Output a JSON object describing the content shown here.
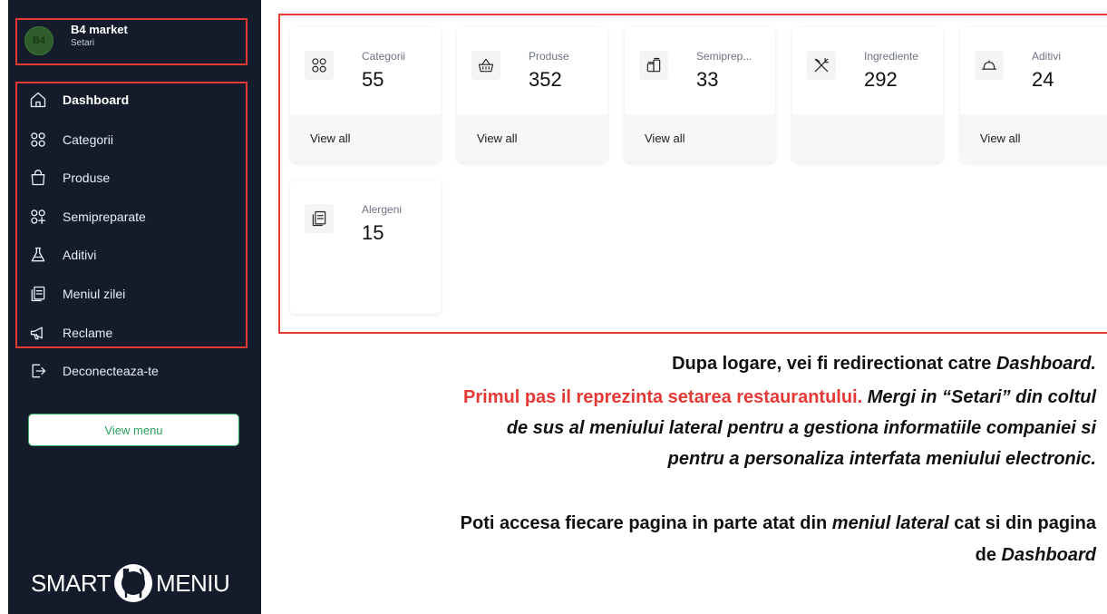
{
  "brand": {
    "avatar_text": "B4",
    "name": "B4 market",
    "subtitle": "Setari"
  },
  "nav": [
    {
      "label": "Dashboard",
      "icon": "home-icon",
      "active": true
    },
    {
      "label": "Categorii",
      "icon": "grid-icon",
      "active": false
    },
    {
      "label": "Produse",
      "icon": "bag-icon",
      "active": false
    },
    {
      "label": "Semipreparate",
      "icon": "grid-plus-icon",
      "active": false
    },
    {
      "label": "Aditivi",
      "icon": "flask-icon",
      "active": false
    },
    {
      "label": "Meniul zilei",
      "icon": "clipboard-icon",
      "active": false
    },
    {
      "label": "Reclame",
      "icon": "megaphone-icon",
      "active": false
    }
  ],
  "logout": {
    "label": "Deconecteaza-te",
    "icon": "logout-icon"
  },
  "view_menu": "View menu",
  "logo": {
    "left": "SMART",
    "right": "MENIU"
  },
  "cards": [
    {
      "label": "Categorii",
      "value": "55",
      "icon": "grid-icon",
      "link": "View all"
    },
    {
      "label": "Produse",
      "value": "352",
      "icon": "basket-icon",
      "link": "View all"
    },
    {
      "label": "Semiprep...",
      "value": "33",
      "icon": "jars-icon",
      "link": "View all"
    },
    {
      "label": "Ingrediente",
      "value": "292",
      "icon": "utensils-icon",
      "link": ""
    },
    {
      "label": "Aditivi",
      "value": "24",
      "icon": "cloche-icon",
      "link": "View all"
    },
    {
      "label": "Alergeni",
      "value": "15",
      "icon": "clipboard-icon",
      "link": ""
    }
  ],
  "text": {
    "line1_a": "Dupa logare, vei fi redirectionat catre ",
    "line1_b": "Dashboard.",
    "line2_red": "Primul pas il reprezinta setarea restaurantului. ",
    "line2_b": "Mergi in “Setari” din coltul",
    "line3": "de sus al meniului lateral pentru a gestiona informatiile companiei si",
    "line4": "pentru a personaliza interfata meniului electronic.",
    "line5_a": "Poti accesa fiecare pagina in parte atat din ",
    "line5_b": "meniul lateral",
    "line5_c": " cat si din pagina",
    "line6_a": "de ",
    "line6_b": "Dashboard"
  },
  "colors": {
    "sidebar": "#141c2c",
    "highlight": "#e53935",
    "accent": "#26a35c"
  }
}
